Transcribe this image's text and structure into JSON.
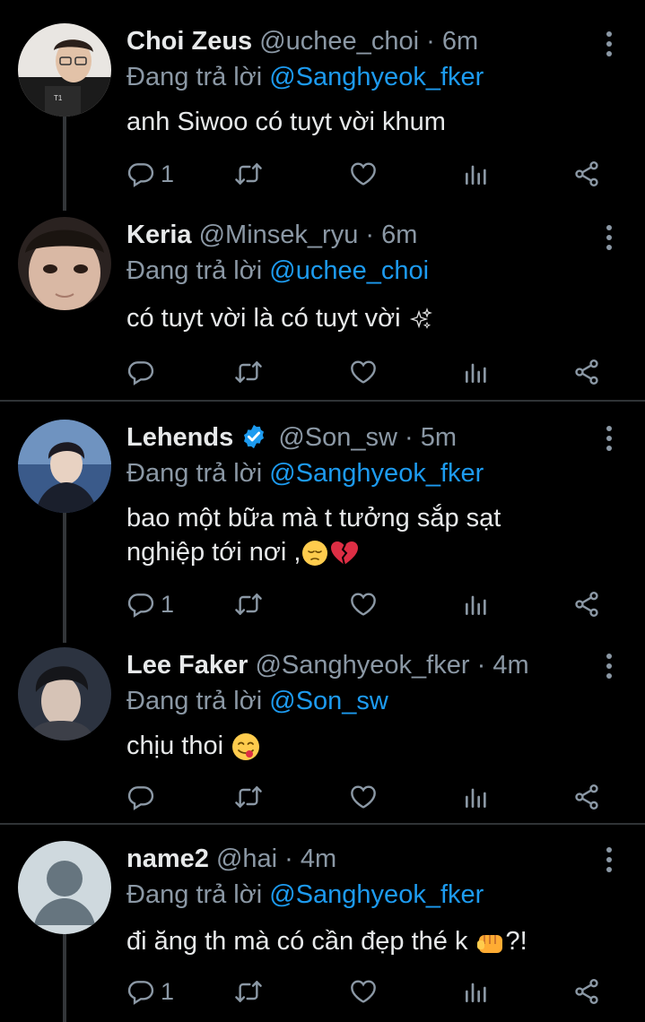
{
  "tweets": [
    {
      "name": "Choi Zeus",
      "handle": "@uchee_choi",
      "sep": "·",
      "time": "6m",
      "replying_prefix": "Đang trả lời",
      "replying_to": "@Sanghyeok_fker",
      "text": "anh Siwoo có tuyt vời khum",
      "reply_count": "1",
      "verified": false
    },
    {
      "name": "Keria",
      "handle": "@Minsek_ryu",
      "sep": "·",
      "time": "6m",
      "replying_prefix": "Đang trả lời",
      "replying_to": "@uchee_choi",
      "text": "có tuyt vời là có tuyt vời",
      "reply_count": "",
      "verified": false
    },
    {
      "name": "Lehends",
      "handle": "@Son_sw",
      "sep": "·",
      "time": "5m",
      "replying_prefix": "Đang trả lời",
      "replying_to": "@Sanghyeok_fker",
      "text_line1": "bao một bữa mà t tưởng sắp sạt",
      "text_line2": "nghiệp tới nơi ,",
      "reply_count": "1",
      "verified": true
    },
    {
      "name": "Lee Faker",
      "handle": "@Sanghyeok_fker",
      "sep": "·",
      "time": "4m",
      "replying_prefix": "Đang trả lời",
      "replying_to": "@Son_sw",
      "text": "chịu thoi",
      "reply_count": "",
      "verified": false
    },
    {
      "name": "name2",
      "handle": "@hai",
      "sep": "·",
      "time": "4m",
      "replying_prefix": "Đang trả lời",
      "replying_to": "@Sanghyeok_fker",
      "text_before": "đi ăng th mà có cần đẹp thé k ",
      "text_after": "?!",
      "reply_count": "1",
      "verified": false
    }
  ],
  "icons": {
    "reply": "reply-icon",
    "retweet": "retweet-icon",
    "like": "heart-icon",
    "views": "analytics-icon",
    "share": "share-icon",
    "more": "more-vertical-icon"
  },
  "colors": {
    "background": "#000000",
    "text": "#e7e9ea",
    "secondary": "#8b98a5",
    "accent": "#1d9bf0",
    "divider": "#2f3336"
  }
}
